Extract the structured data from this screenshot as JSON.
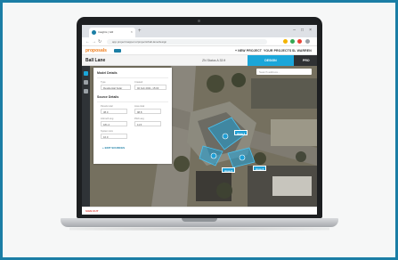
{
  "browser": {
    "tab_title": "Insights | GR",
    "close_glyph": "×",
    "new_tab_glyph": "+",
    "window_controls": [
      "–",
      "□",
      "×"
    ],
    "url": "app.projectmapper.io/projects/ball-lane/design",
    "back_glyph": "←",
    "forward_glyph": "→",
    "reload_glyph": "↻"
  },
  "app": {
    "logo_text": "proposals",
    "nav": {
      "new_project": "+ NEW PROJECT",
      "your_projects": "YOUR PROJECTS",
      "account": "SL WARREN"
    }
  },
  "project": {
    "title": "Ball Lane",
    "subtitle": "ZN Status A 33 ft",
    "tab_active": "DESIGN",
    "tab_next": "PRO"
  },
  "map": {
    "search_placeholder": "Search address...",
    "areas": [
      {
        "label": "Area 1"
      },
      {
        "label": "Area 2"
      },
      {
        "label": "Area 3"
      }
    ]
  },
  "panel": {
    "section1_title": "Model Details",
    "field_a_label": "Type",
    "field_a_value": "Residential Solar",
    "field_b_label": "Created",
    "field_b_value": "02 Feb 2021, 15:00",
    "section2_title": "Source Details",
    "f1_label": "Panels total",
    "f1_value": "38.0",
    "f2_label": "Area total",
    "f2_value": "98.8",
    "f3_label": "Azimuth avg",
    "f3_value": "181.2",
    "f4_label": "Pitch avg",
    "f4_value": "11.5",
    "f5_label": "System size",
    "f5_value": "16.0",
    "link": "+ EDIT SOURCES"
  },
  "footer": {
    "link": "SIGN OUT"
  },
  "colors": {
    "frame": "#1b7ea5",
    "accent": "#1ba6d9",
    "logo": "#f07d1a"
  }
}
